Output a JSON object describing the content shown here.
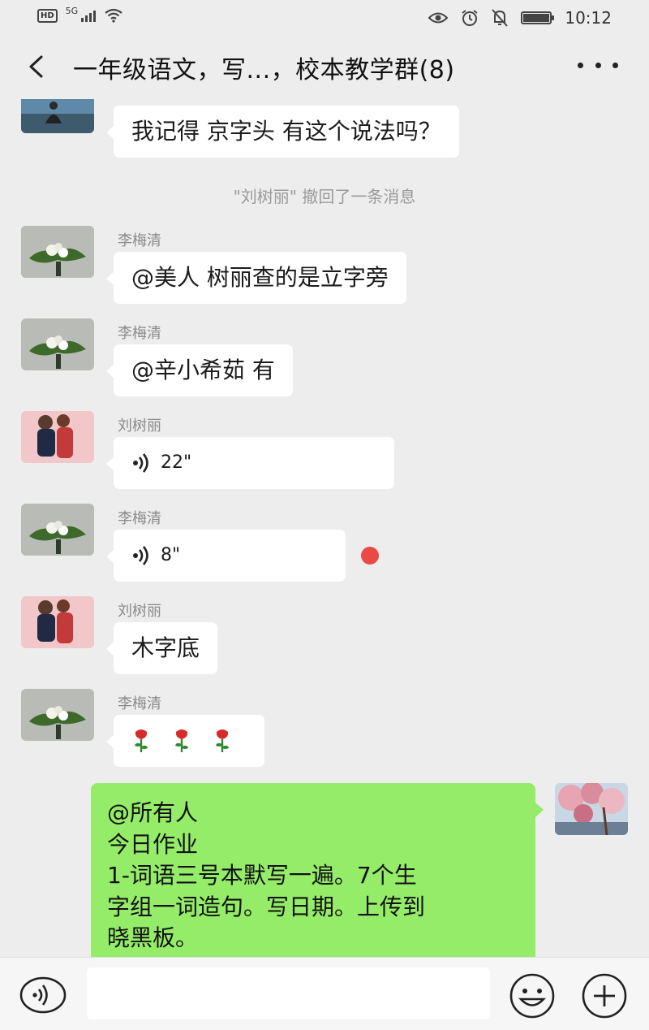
{
  "status_bar": {
    "hd": "HD",
    "network": "5G",
    "time": "10:12"
  },
  "header": {
    "back_icon": "chevron-left-icon",
    "title": "一年级语文，写...，校本教学群(8)",
    "more_icon": "more-horizontal-icon"
  },
  "messages": [
    {
      "sender": "",
      "text": "我记得 京字头 有这个说法吗？"
    },
    {
      "system": "\"刘树丽\" 撤回了一条消息"
    },
    {
      "sender": "李梅清",
      "text": "@美人  树丽查的是立字旁"
    },
    {
      "sender": "李梅清",
      "text": "@辛小希茹  有"
    },
    {
      "sender": "刘树丽",
      "voice_duration": "22\""
    },
    {
      "sender": "李梅清",
      "voice_duration": "8\"",
      "unread": true
    },
    {
      "sender": "刘树丽",
      "text": "木字底"
    },
    {
      "sender": "李梅清",
      "emoji": "rose-icon",
      "count": 3
    },
    {
      "self": true,
      "lines": [
        "@所有人",
        "今日作业",
        "1-词语三号本默写一遍。7个生",
        "字组一词造句。写日期。上传到",
        "晓黑板。"
      ]
    }
  ],
  "input_bar": {
    "voice_icon": "voice-input-icon",
    "placeholder": "",
    "emoji_icon": "emoji-icon",
    "plus_icon": "plus-icon"
  },
  "colors": {
    "background": "#ededed",
    "bubble_self": "#95ec69",
    "bubble_other": "#ffffff",
    "unread_dot": "#ea4a45"
  }
}
